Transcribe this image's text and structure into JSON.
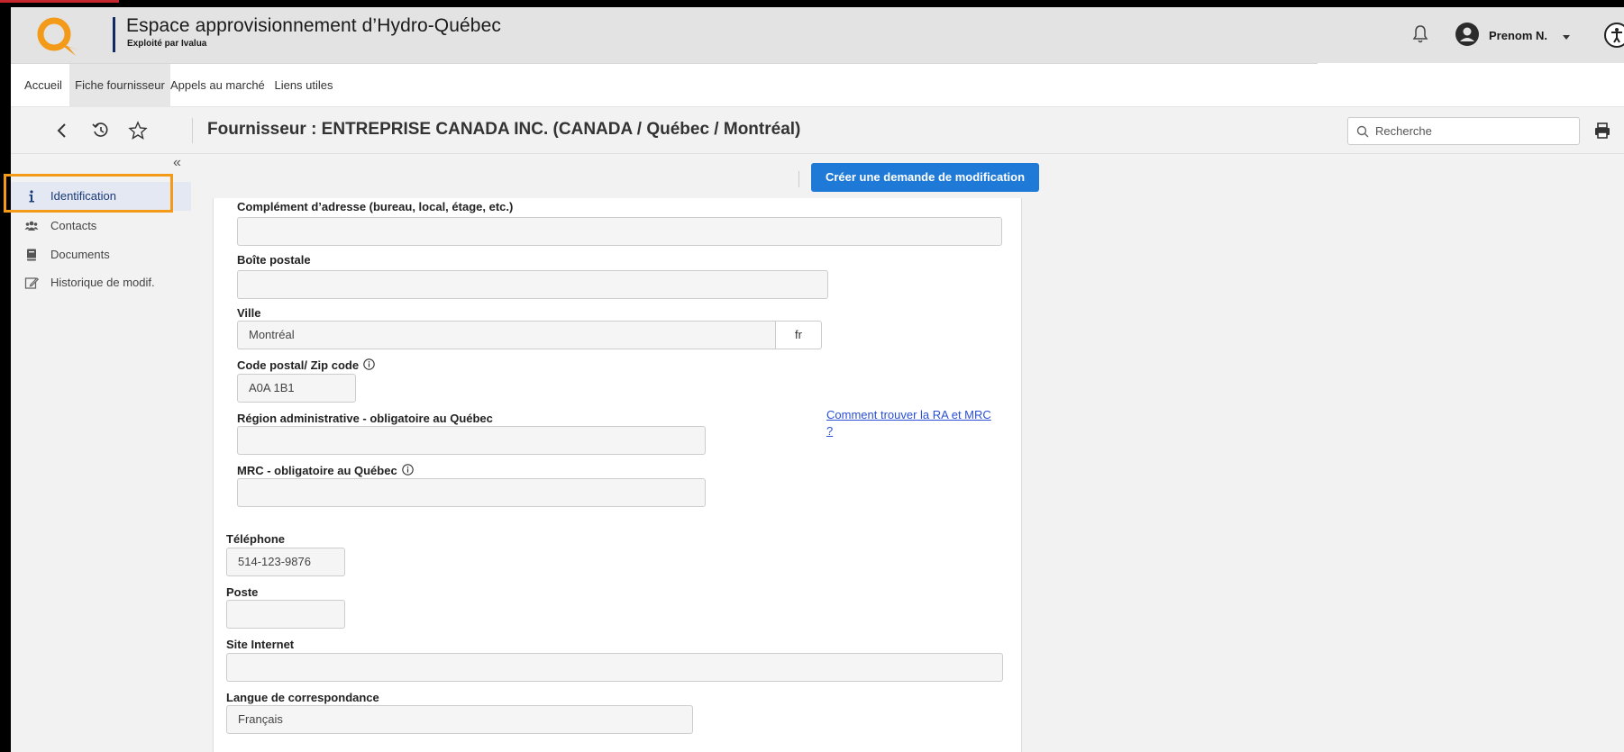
{
  "header": {
    "title": "Espace approvisionnement d’Hydro-Québec",
    "subtitle": "Exploité par Ivalua",
    "user_name": "Prenom N.",
    "icons": [
      "q-logo",
      "bell-icon",
      "user-avatar-icon",
      "chevron-down-icon",
      "accessibility-icon"
    ],
    "colors": {
      "logo_orange": "#f39a19",
      "brand_navy": "#0f2b61"
    }
  },
  "nav": {
    "tabs": [
      {
        "label": "Accueil",
        "active": false
      },
      {
        "label": "Fiche fournisseur",
        "active": true
      },
      {
        "label": "Appels au marché",
        "active": false
      },
      {
        "label": "Liens utiles",
        "active": false
      }
    ]
  },
  "toolbar": {
    "icons": [
      "back-icon",
      "history-icon",
      "star-icon",
      "search-icon",
      "print-icon"
    ],
    "page_title": "Fournisseur : ENTREPRISE CANADA INC. (CANADA / Québec / Montréal)",
    "search_placeholder": "Recherche"
  },
  "sidebar": {
    "collapse_glyph": "«",
    "items": [
      {
        "label": "Identification",
        "icon": "info-icon",
        "active": true
      },
      {
        "label": "Contacts",
        "icon": "users-icon",
        "active": false
      },
      {
        "label": "Documents",
        "icon": "book-icon",
        "active": false
      },
      {
        "label": "Historique de modif.",
        "icon": "edit-icon",
        "active": false
      }
    ],
    "highlight_color": "#f39a19"
  },
  "main": {
    "create_button": "Créer une demande de modification",
    "button_color": "#1e7ad6"
  },
  "form": {
    "complement_label": "Complément d’adresse (bureau, local, étage, etc.)",
    "complement_value": "",
    "boite_label": "Boîte postale",
    "boite_value": "",
    "ville_label": "Ville",
    "ville_value": "Montréal",
    "ville_lang": "fr",
    "code_postal_label": "Code postal/ Zip code",
    "code_postal_value": "A0A 1B1",
    "region_label": "Région administrative - obligatoire au Québec",
    "region_value": "",
    "ra_link": "Comment trouver la RA et MRC ?",
    "mrc_label": "MRC - obligatoire au Québec",
    "mrc_value": "",
    "telephone_label": "Téléphone",
    "telephone_value": "514-123-9876",
    "poste_label": "Poste",
    "poste_value": "",
    "site_label": "Site Internet",
    "site_value": "",
    "langue_label": "Langue de correspondance",
    "langue_value": "Français"
  }
}
